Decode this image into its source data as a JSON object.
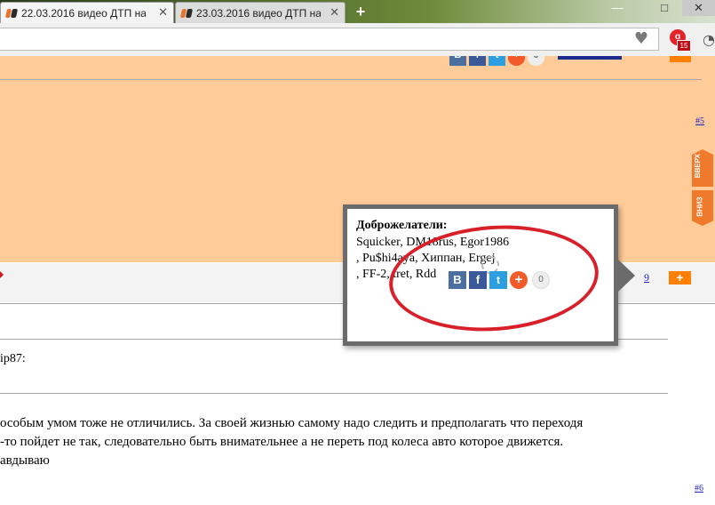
{
  "tabs": [
    {
      "title": "22.03.2016 видео ДТП на",
      "close": "✕"
    },
    {
      "title": "23.03.2016 видео ДТП на",
      "close": "✕"
    }
  ],
  "new_tab_label": "+",
  "window_controls": {
    "minimize": "—",
    "maximize": "□",
    "close": "✕"
  },
  "address_bar": {
    "value": ""
  },
  "share_top": {
    "vk": "B",
    "fb": "f",
    "tw": "t",
    "plus": "+",
    "count": "0"
  },
  "post_numbers": {
    "upper": "#5",
    "lower": "#6"
  },
  "side_nav": {
    "up": "ВВЕРХ",
    "down": "ВНИЗ"
  },
  "comment_row": {
    "rating": "9",
    "plus": "+"
  },
  "quote_author": "ip87:",
  "post_lines": [
    "особым умом тоже не отличились. За своей жизнью самому надо следить и предполагать что переходя",
    "-то пойдет не так, следовательно быть внимательнее а не переть под колеса авто которое движется.",
    "авдываю"
  ],
  "popup": {
    "title": "Доброжелатели:",
    "names_line1": "Squicker, DM18rus, Egor1986",
    "names_line2": ", Pu$hi4aya, Хиппан, Ergej",
    "names_line3": ", FF-2, tret, Rdd",
    "share": {
      "vk": "B",
      "fb": "f",
      "tw": "t",
      "plus": "+",
      "count": "0"
    }
  },
  "colors": {
    "page_orange": "#ffcc99",
    "accent_orange": "#ff7f00",
    "annotation_red": "#d8202a",
    "popup_border": "#6b6b6b"
  }
}
